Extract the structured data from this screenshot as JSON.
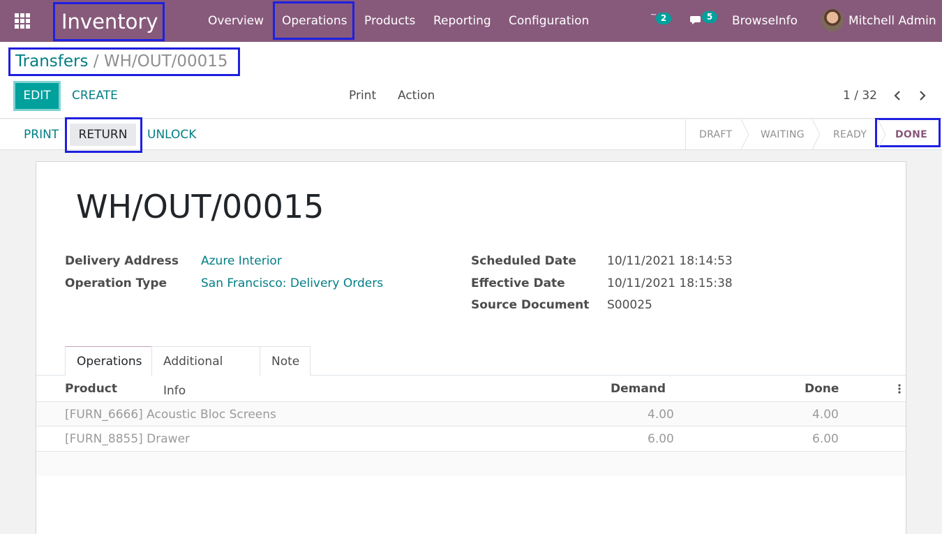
{
  "navbar": {
    "app_name": "Inventory",
    "menu": [
      "Overview",
      "Operations",
      "Products",
      "Reporting",
      "Configuration"
    ],
    "activity_count": "2",
    "messages_count": "5",
    "company": "BrowseInfo",
    "user": "Mitchell Admin",
    "bg_color": "#875a7b"
  },
  "breadcrumb": {
    "parent": "Transfers",
    "separator": "/",
    "current": "WH/OUT/00015"
  },
  "control_panel": {
    "edit": "EDIT",
    "create": "CREATE",
    "print": "Print",
    "action": "Action",
    "pager": "1 / 32"
  },
  "statusbar": {
    "buttons": [
      "PRINT",
      "RETURN",
      "UNLOCK"
    ],
    "stages": [
      "DRAFT",
      "WAITING",
      "READY",
      "DONE"
    ],
    "active_stage": "DONE"
  },
  "record": {
    "name": "WH/OUT/00015",
    "fields_left": [
      {
        "label": "Delivery Address",
        "value": "Azure Interior"
      },
      {
        "label": "Operation Type",
        "value": "San Francisco: Delivery Orders"
      }
    ],
    "fields_right": [
      {
        "label": "Scheduled Date",
        "value": "10/11/2021 18:14:53"
      },
      {
        "label": "Effective Date",
        "value": "10/11/2021 18:15:38"
      },
      {
        "label": "Source Document",
        "value": "S00025"
      }
    ]
  },
  "tabs": [
    "Operations",
    "Additional Info",
    "Note"
  ],
  "operations_table": {
    "columns": [
      "Product",
      "Demand",
      "Done"
    ],
    "rows": [
      {
        "product": "[FURN_6666] Acoustic Bloc Screens",
        "demand": "4.00",
        "done": "4.00"
      },
      {
        "product": "[FURN_8855] Drawer",
        "demand": "6.00",
        "done": "6.00"
      }
    ]
  },
  "colors": {
    "primary": "#00a09d",
    "link": "#017e84",
    "brand": "#875a7b"
  }
}
